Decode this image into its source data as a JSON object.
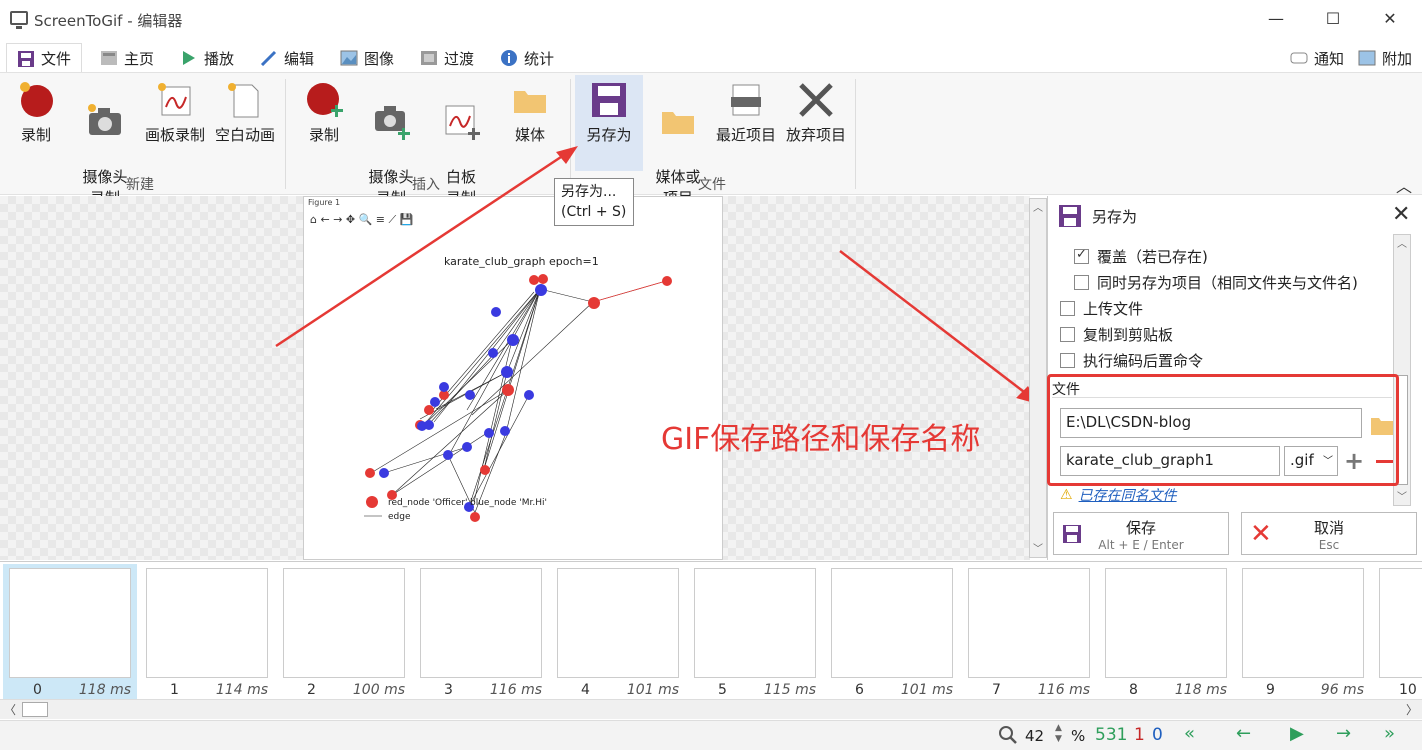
{
  "window": {
    "title": "ScreenToGif - 编辑器",
    "minimize": "—",
    "maximize": "☐",
    "close": "✕"
  },
  "tabs": [
    {
      "label": "文件",
      "icon": "save-icon"
    },
    {
      "label": "主页",
      "icon": "home-icon"
    },
    {
      "label": "播放",
      "icon": "play-icon"
    },
    {
      "label": "编辑",
      "icon": "pencil-icon"
    },
    {
      "label": "图像",
      "icon": "image-icon"
    },
    {
      "label": "过渡",
      "icon": "transition-icon"
    },
    {
      "label": "统计",
      "icon": "info-icon"
    }
  ],
  "top_right": {
    "notify": "通知",
    "extra": "附加"
  },
  "ribbon": {
    "new": {
      "group": "新建",
      "buttons": [
        "录制",
        "摄像头\n录制",
        "画板录制",
        "空白动画"
      ]
    },
    "insert": {
      "group": "插入",
      "buttons": [
        "录制",
        "摄像头\n录制",
        "白板\n录制",
        "媒体"
      ]
    },
    "file": {
      "group": "文件",
      "buttons": [
        "另存为",
        "媒体或\n项目",
        "最近项目",
        "放弃项目"
      ]
    }
  },
  "tooltip": {
    "line1": "另存为...",
    "line2": "(Ctrl + S)"
  },
  "plot": {
    "title": "karate_club_graph epoch=1",
    "legend_red": "red_node 'Officer'",
    "legend_blue": "blue_node 'Mr.Hi'",
    "legend_edge": "edge",
    "window_label": "Figure 1"
  },
  "panel": {
    "title": "另存为",
    "options": [
      {
        "label": "覆盖（若已存在)",
        "checked": true
      },
      {
        "label": "同时另存为项目（相同文件夹与文件名)",
        "checked": false
      },
      {
        "label": "上传文件",
        "checked": false
      },
      {
        "label": "复制到剪贴板",
        "checked": false
      },
      {
        "label": "执行编码后置命令",
        "checked": false
      }
    ],
    "file_section": "文件",
    "path": "E:\\DL\\CSDN-blog",
    "filename": "karate_club_graph1",
    "extension": ".gif",
    "warning": "已存在同名文件",
    "save": {
      "label": "保存",
      "shortcut": "Alt + E / Enter"
    },
    "cancel": {
      "label": "取消",
      "shortcut": "Esc"
    }
  },
  "annotation": "GIF保存路径和保存名称",
  "frames": [
    {
      "num": "0",
      "ms": "118 ms"
    },
    {
      "num": "1",
      "ms": "114 ms"
    },
    {
      "num": "2",
      "ms": "100 ms"
    },
    {
      "num": "3",
      "ms": "116 ms"
    },
    {
      "num": "4",
      "ms": "101 ms"
    },
    {
      "num": "5",
      "ms": "115 ms"
    },
    {
      "num": "6",
      "ms": "101 ms"
    },
    {
      "num": "7",
      "ms": "116 ms"
    },
    {
      "num": "8",
      "ms": "118 ms"
    },
    {
      "num": "9",
      "ms": "96 ms"
    },
    {
      "num": "10",
      "ms": ""
    }
  ],
  "status": {
    "zoom": "42",
    "percent": "%",
    "total": "531",
    "selected": "1",
    "current": "0"
  },
  "colors": {
    "accent": "#e53935",
    "selection": "#cde8f7",
    "green": "#2e9e5b"
  }
}
